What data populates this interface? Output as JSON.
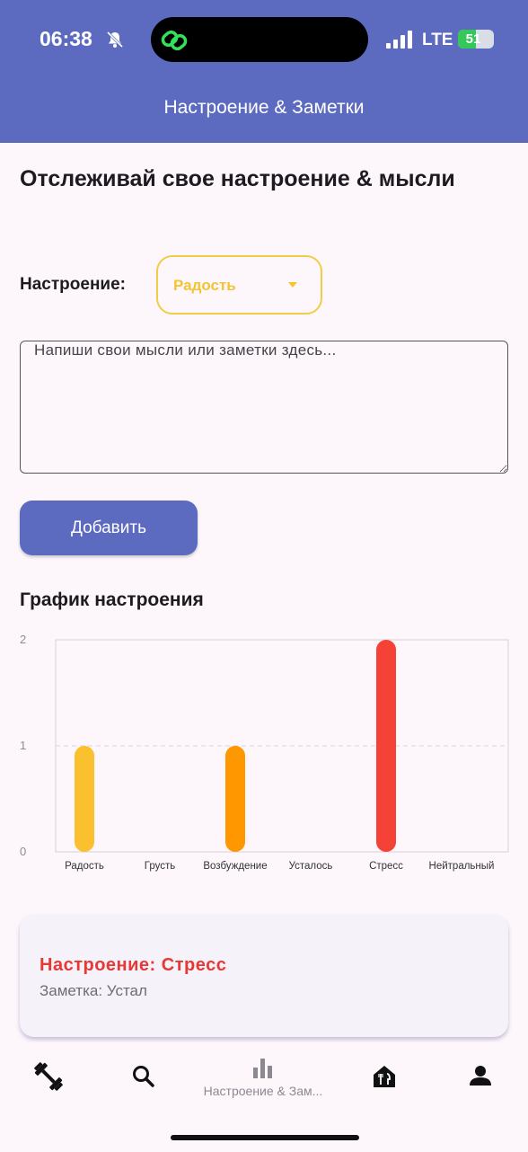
{
  "status_bar": {
    "time": "06:38",
    "network": "LTE",
    "battery": "51",
    "battery_fraction": 0.51
  },
  "app_bar": {
    "title": "Настроение & Заметки"
  },
  "page": {
    "heading": "Отслеживай свое настроение & мысли",
    "mood_label": "Настроение:",
    "mood_selected": "Радость",
    "notes_placeholder": "Напиши свои мысли или заметки здесь...",
    "add_button": "Добавить",
    "chart_title": "График настроения"
  },
  "chart_data": {
    "type": "bar",
    "categories": [
      "Радость",
      "Грусть",
      "Возбуждение",
      "Усталось",
      "Стресс",
      "Нейтральный"
    ],
    "values": [
      1,
      0,
      1,
      0,
      2,
      0
    ],
    "colors": [
      "#fbc02d",
      "#fbc02d",
      "#ff9800",
      "#ff9800",
      "#f44336",
      "#f44336"
    ],
    "yticks": [
      0,
      1,
      2
    ],
    "ylim": [
      0,
      2
    ],
    "grid": "dashed at 1"
  },
  "entry_card": {
    "mood": "Настроение: Стресс",
    "note": "Заметка: Устал"
  },
  "bottom_nav": {
    "items": [
      {
        "icon": "dumbbell-icon"
      },
      {
        "icon": "search-icon"
      },
      {
        "icon": "bar-chart-icon",
        "label": "Настроение & Зам..."
      },
      {
        "icon": "restaurant-icon"
      },
      {
        "icon": "person-icon"
      }
    ]
  },
  "colors": {
    "primary": "#5c6bc0",
    "accent_yellow": "#f4c430",
    "stress_red": "#e53935",
    "background": "#fdf7fc"
  }
}
